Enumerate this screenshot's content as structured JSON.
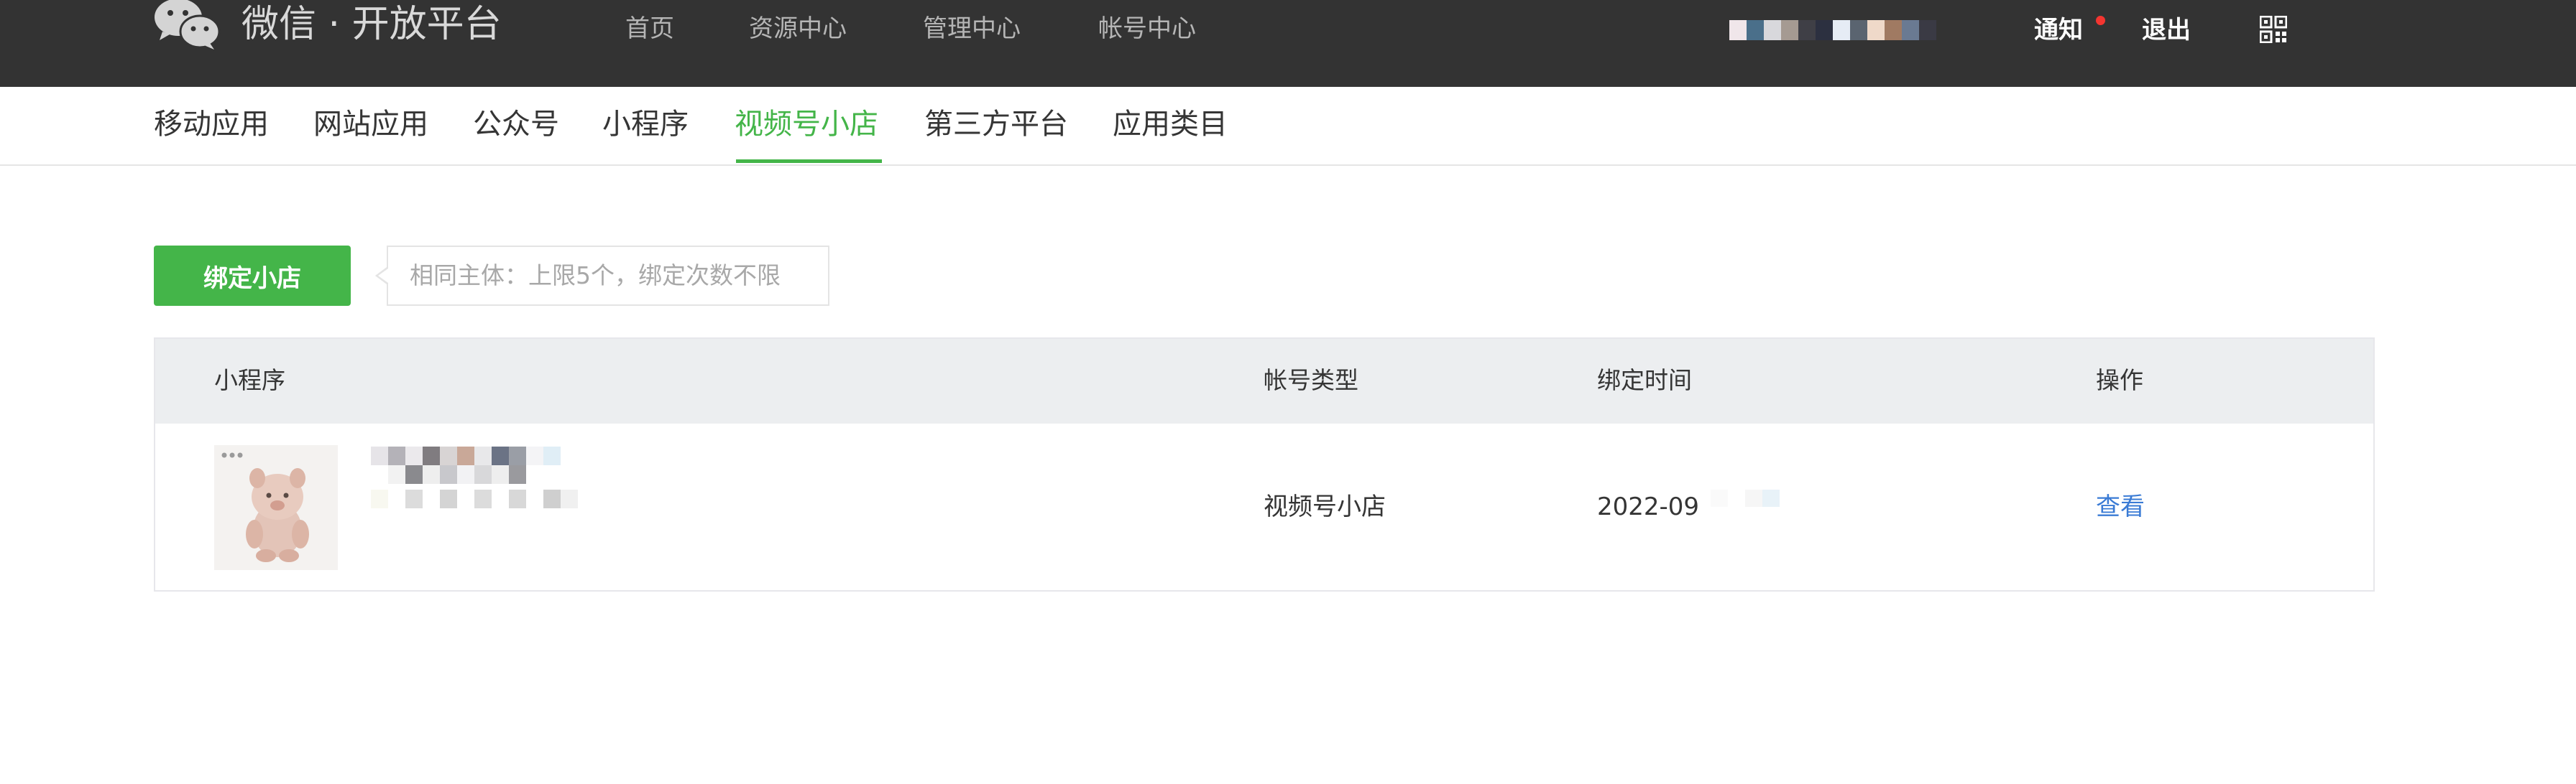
{
  "header": {
    "logo_icon": "wechat-logo-icon",
    "brand": "微信 · 开放平台",
    "nav": [
      {
        "label": "首页"
      },
      {
        "label": "资源中心"
      },
      {
        "label": "管理中心"
      },
      {
        "label": "帐号中心"
      }
    ],
    "notify_label": "通知",
    "logout_label": "退出",
    "qr_icon": "qrcode-icon",
    "notify_dot_color": "#f43530"
  },
  "subnav": {
    "items": [
      {
        "label": "移动应用"
      },
      {
        "label": "网站应用"
      },
      {
        "label": "公众号"
      },
      {
        "label": "小程序"
      },
      {
        "label": "视频号小店"
      },
      {
        "label": "第三方平台"
      },
      {
        "label": "应用类目"
      }
    ],
    "active_index": 4,
    "active_color": "#44b549"
  },
  "toolbar": {
    "bind_button_label": "绑定小店",
    "hint": "相同主体：上限5个，绑定次数不限",
    "button_color": "#44b549"
  },
  "table": {
    "columns": [
      "小程序",
      "帐号类型",
      "绑定时间",
      "操作"
    ],
    "rows": [
      {
        "account_type": "视频号小店",
        "bind_time": "2022-09",
        "action": "查看"
      }
    ]
  },
  "colors": {
    "header_bg": "#333333",
    "link": "#3a7bd5"
  }
}
